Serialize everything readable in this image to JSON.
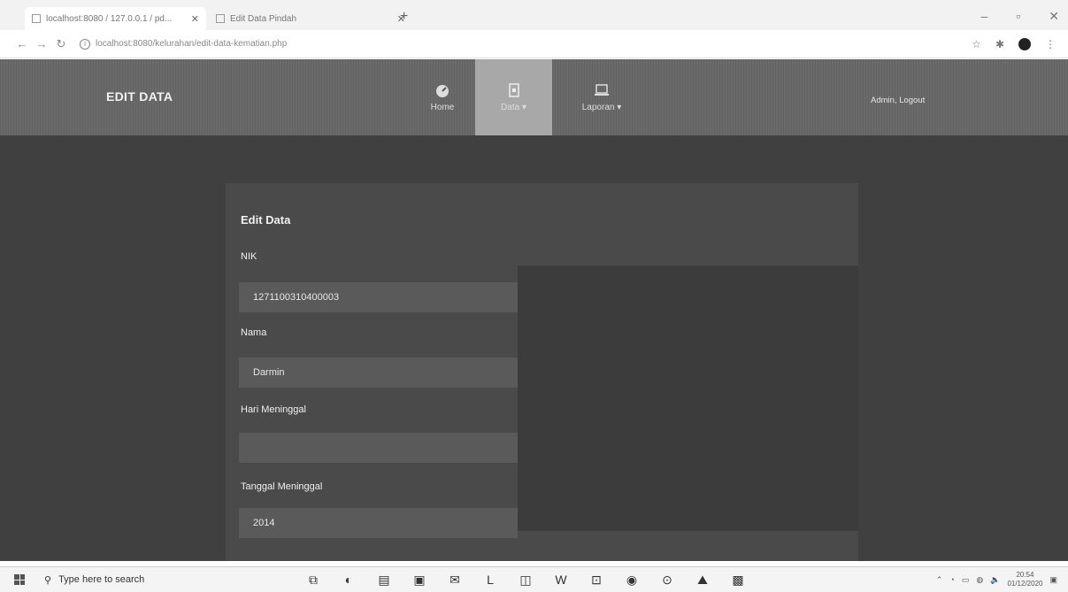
{
  "browser": {
    "tabs": [
      {
        "title": "localhost:8080 / 127.0.0.1 / pd..."
      },
      {
        "title": "Edit Data Pindah"
      }
    ],
    "url": "localhost:8080/kelurahan/edit-data-kematian.php"
  },
  "navbar": {
    "brand": "EDIT DATA",
    "items": [
      {
        "label": "Home",
        "icon": "dashboard-icon"
      },
      {
        "label": "Data ▾",
        "icon": "document-icon"
      },
      {
        "label": "Laporan ▾",
        "icon": "laptop-icon"
      }
    ],
    "user": "Admin, Logout"
  },
  "form": {
    "title": "Edit Data",
    "nik_label": "NIK",
    "nik_value": "1271100310400003",
    "nama_label": "Nama",
    "nama_value": "Darmin",
    "hari_label": "Hari Meninggal",
    "hari_value": "",
    "tanggal_label": "Tanggal Meninggal",
    "tanggal_value": "2014"
  },
  "taskbar": {
    "search_placeholder": "Type here to search",
    "time": "20:54",
    "date": "01/12/2020"
  }
}
